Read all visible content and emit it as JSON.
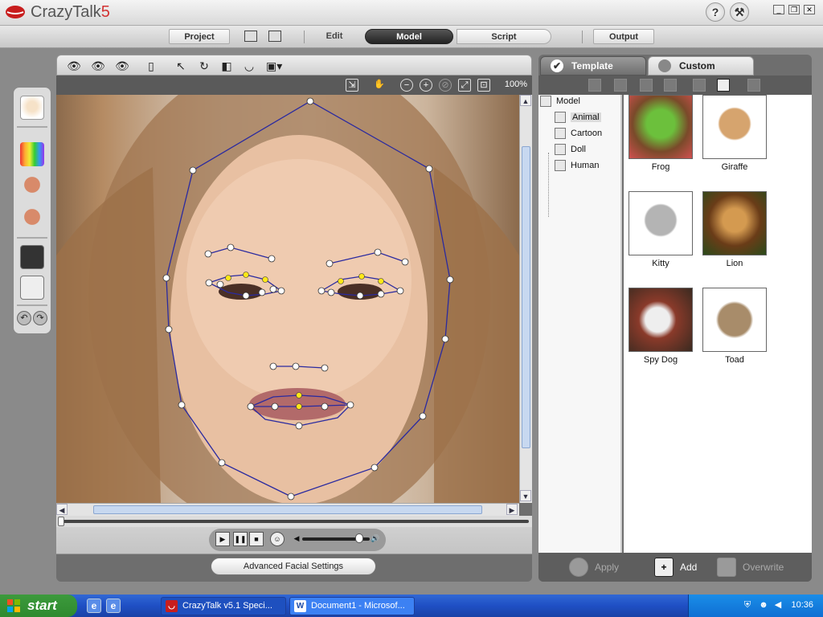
{
  "app": {
    "title_main": "CrazyTalk",
    "title_version": "5"
  },
  "titlebar": {
    "help": "?",
    "tools": "tools"
  },
  "menu": {
    "project": "Project",
    "edit": "Edit",
    "model": "Model",
    "script": "Script",
    "output": "Output"
  },
  "viewer": {
    "zoom": "100%",
    "advanced_button": "Advanced Facial Settings"
  },
  "right_panel": {
    "tabs": {
      "template": "Template",
      "custom": "Custom"
    },
    "tree": {
      "root": "Model",
      "items": [
        "Animal",
        "Cartoon",
        "Doll",
        "Human"
      ],
      "selected": "Animal"
    },
    "gallery": [
      {
        "label": "Frog",
        "color": "#5a9a3a"
      },
      {
        "label": "Giraffe",
        "color": "#c8a070"
      },
      {
        "label": "Kitty",
        "color": "#b8b8b8"
      },
      {
        "label": "Lion",
        "color": "#b07a3a"
      },
      {
        "label": "Spy Dog",
        "color": "#8a3a2a"
      },
      {
        "label": "Toad",
        "color": "#a88c6a"
      }
    ],
    "actions": {
      "apply": "Apply",
      "add": "Add",
      "overwrite": "Overwrite"
    }
  },
  "taskbar": {
    "start": "start",
    "tasks": [
      "CrazyTalk v5.1 Speci...",
      "Document1 - Microsof..."
    ],
    "clock": "10:36"
  },
  "colors": {
    "accent_red": "#d23232",
    "mesh_line": "#2a2aa0",
    "xp_blue": "#1f4fc4"
  }
}
